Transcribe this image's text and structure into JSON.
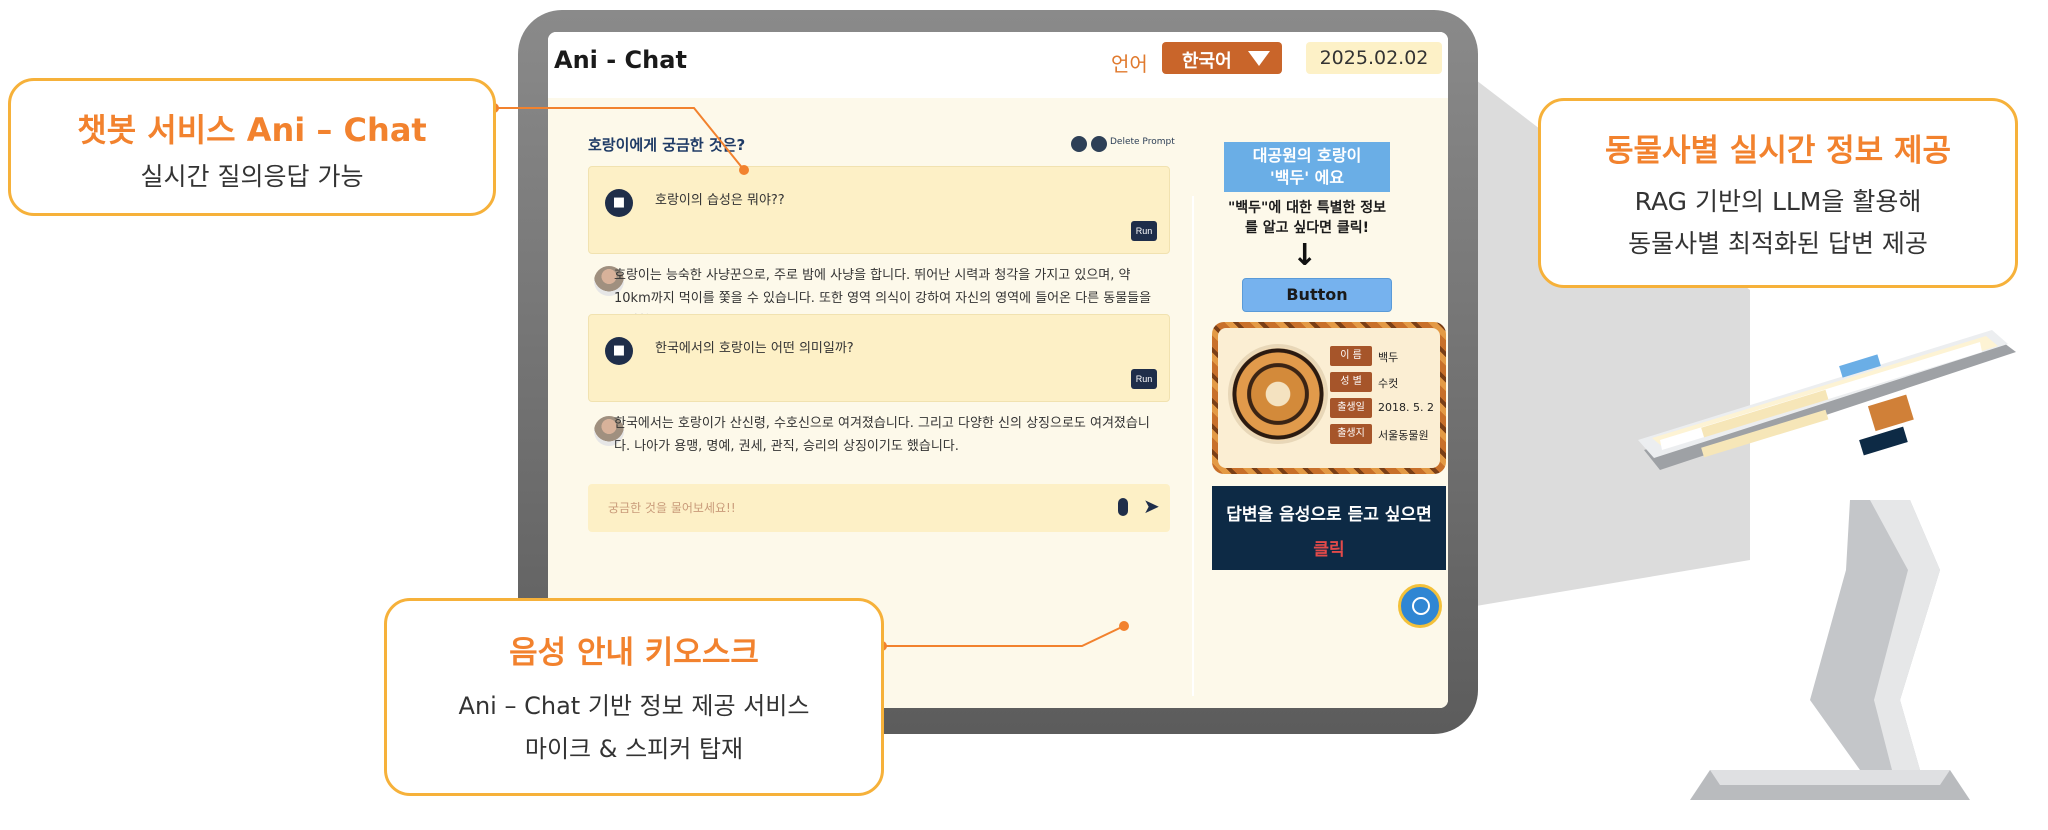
{
  "callouts": {
    "chatbot": {
      "title": "챗봇 서비스 Ani – Chat",
      "sub": "실시간 질의응답 가능"
    },
    "realtime": {
      "title": "동물사별 실시간 정보 제공",
      "sub1": "RAG 기반의 LLM을 활용해",
      "sub2": "동물사별 최적화된 답변 제공"
    },
    "kiosk": {
      "title": "음성 안내 키오스크",
      "sub1": "Ani – Chat 기반 정보 제공 서비스",
      "sub2": "마이크 & 스피커 탑재"
    }
  },
  "app": {
    "title": "Ani - Chat",
    "lang_label": "언어",
    "lang_value": "한국어",
    "date": "2025.02.02",
    "question_title": "호랑이에게 궁금한 것은?",
    "delete_prompt": "Delete Prompt",
    "run_label": "Run",
    "qa": [
      {
        "question": "호랑이의 습성은 뭐야??",
        "answer": "호랑이는 능숙한 사냥꾼으로, 주로 밤에 사냥을 합니다. 뛰어난 시력과 청각을 가지고 있으며, 약 10km까지 먹이를 쫓을 수 있습니다. 또한 영역 의식이 강하여 자신의 영역에 들어온 다른 동물들을 공격합니다."
      },
      {
        "question": "한국에서의 호랑이는 어떤 의미일까?",
        "answer": "한국에서는 호랑이가 산신령, 수호신으로 여겨졌습니다. 그리고 다양한 신의 상징으로도 여겨졌습니다. 나아가 용맹, 명예, 권세, 관직, 승리의 상징이기도 했습니다."
      }
    ],
    "input_placeholder": "궁금한 것을 물어보세요!!",
    "panel": {
      "title_line1": "대공원의 호랑이",
      "title_line2": "'백두' 에요",
      "sub_line1": "\"백두\"에 대한 특별한 정보",
      "sub_line2": "를 알고 싶다면 클릭!",
      "arrow": "↓",
      "button_label": "Button",
      "fields": [
        {
          "label": "이  름",
          "value": "백두"
        },
        {
          "label": "성  별",
          "value": "수컷"
        },
        {
          "label": "출생일",
          "value": "2018. 5. 2"
        },
        {
          "label": "출생지",
          "value": "서울동물원"
        }
      ],
      "voice_line1": "답변을 음성으로 듣고 싶으면",
      "voice_line2": "클릭"
    }
  },
  "icons": {
    "folder": "folder-icon",
    "mic": "microphone-icon",
    "send": "send-icon",
    "chat": "chat-bubble-icon"
  },
  "colors": {
    "accent_orange": "#f2822e",
    "callout_border": "#f6b13a",
    "lang_select": "#c9652a",
    "panel_blue": "#6aaee6",
    "voice_box": "#0d2a45",
    "fab": "#2f86d3"
  }
}
